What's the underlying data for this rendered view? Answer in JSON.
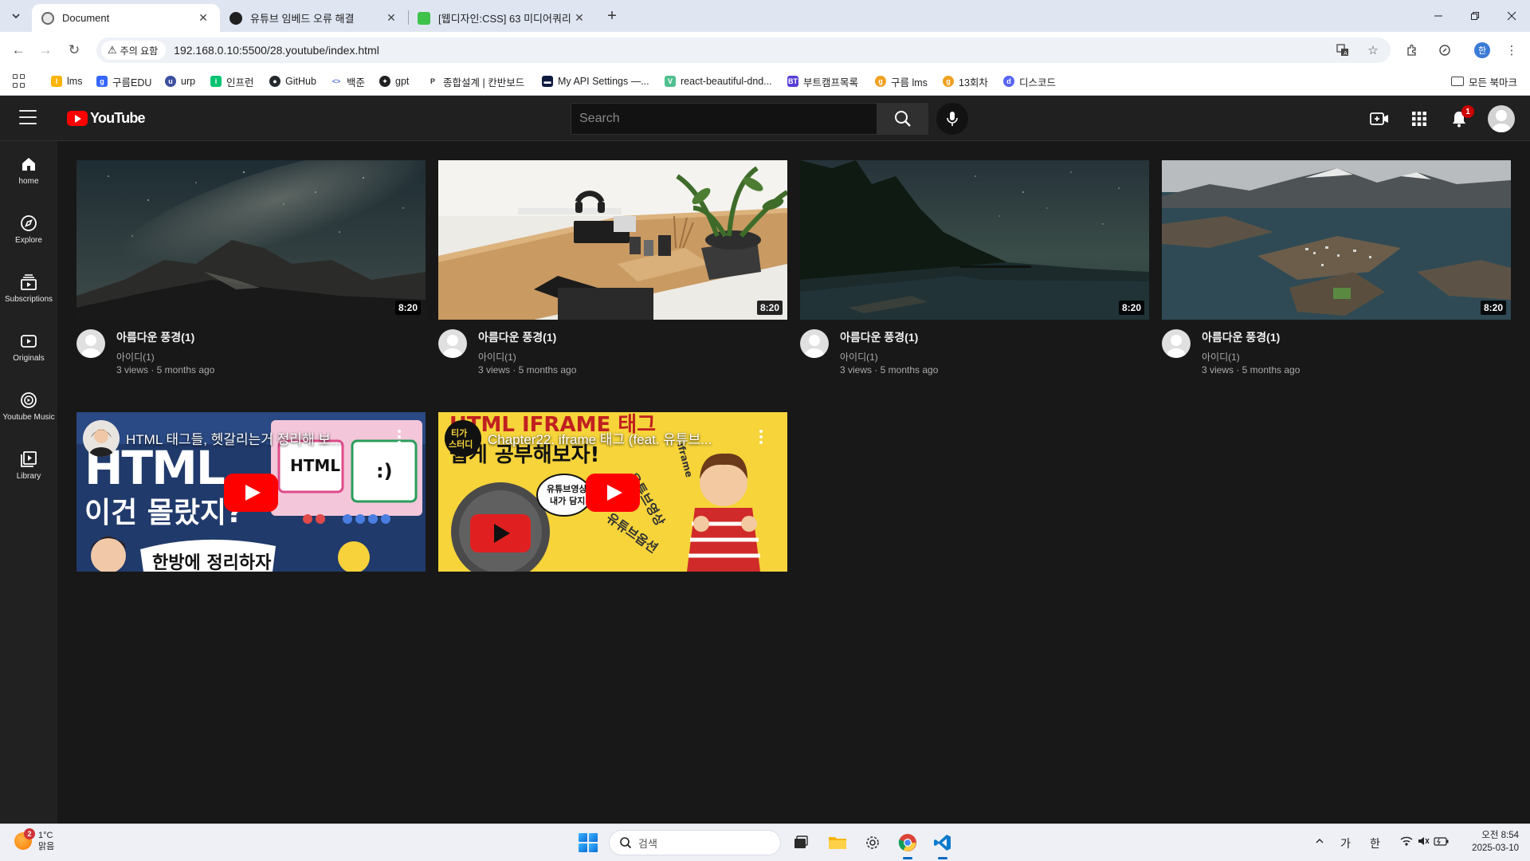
{
  "browser": {
    "tabs": [
      {
        "title": "Document",
        "active": true,
        "favicon_color": "#555555"
      },
      {
        "title": "유튜브 임베드 오류 해결",
        "active": false,
        "favicon_color": "#202020"
      },
      {
        "title": "[웹디자인:CSS] 63 미디어쿼리",
        "active": false,
        "favicon_color": "#3ec24a"
      }
    ],
    "new_tab_icon": "plus-icon",
    "address": {
      "security_label": "주의 요함",
      "url": "192.168.0.10:5500/28.youtube/index.html"
    },
    "bookmarks": [
      {
        "label": "lms",
        "color": "#ffb400"
      },
      {
        "label": "구름EDU",
        "color": "#3566ff"
      },
      {
        "label": "urp",
        "color": "#3b4fa0"
      },
      {
        "label": "인프런",
        "color": "#00c471"
      },
      {
        "label": "GitHub",
        "color": "#24292e"
      },
      {
        "label": "백준",
        "color": "#5b7bd6"
      },
      {
        "label": "gpt",
        "color": "#202020"
      },
      {
        "label": "종합설계 | 칸반보드",
        "color": "#333333"
      },
      {
        "label": "My API Settings —...",
        "color": "#0d1b3e"
      },
      {
        "label": "react-beautiful-dnd...",
        "color": "#4fc08d"
      },
      {
        "label": "부트캠프목록",
        "color": "#5a3fd6"
      },
      {
        "label": "구름 lms",
        "color": "#f0a020"
      },
      {
        "label": "13회차",
        "color": "#f0a020"
      },
      {
        "label": "디스코드",
        "color": "#5865f2"
      }
    ],
    "all_bookmarks": "모든 북마크",
    "profile_initial": "한"
  },
  "youtube": {
    "logo_text": "YouTube",
    "search_placeholder": "Search",
    "notification_count": "1",
    "sidebar": [
      {
        "label": "home",
        "icon": "home-icon"
      },
      {
        "label": "Explore",
        "icon": "compass-icon"
      },
      {
        "label": "Subscriptions",
        "icon": "subscriptions-icon"
      },
      {
        "label": "Originals",
        "icon": "originals-icon"
      },
      {
        "label": "Youtube Music",
        "icon": "music-icon"
      },
      {
        "label": "Library",
        "icon": "library-icon"
      }
    ],
    "videos": [
      {
        "title": "아름다운 풍경(1)",
        "channel": "아이디(1)",
        "stats": "3 views · 5 months ago",
        "duration": "8:20",
        "thumb": "milky-way-mountain"
      },
      {
        "title": "아름다운 풍경(1)",
        "channel": "아이디(1)",
        "stats": "3 views · 5 months ago",
        "duration": "8:20",
        "thumb": "desk-setup"
      },
      {
        "title": "아름다운 풍경(1)",
        "channel": "아이디(1)",
        "stats": "3 views · 5 months ago",
        "duration": "8:20",
        "thumb": "lake-night-sky"
      },
      {
        "title": "아름다운 풍경(1)",
        "channel": "아이디(1)",
        "stats": "3 views · 5 months ago",
        "duration": "8:20",
        "thumb": "island-town-aerial"
      }
    ],
    "embeds": [
      {
        "title": "HTML 태그들, 헷갈리는거 정리해 보...",
        "overlay_text": "HTML 이건 몰랐지? 한방에 정리하자",
        "badge": "HTML",
        "badge2": ":)"
      },
      {
        "title": "Chapter22. iframe 태그 (feat. 유튜브...",
        "overlay_text": "HTML IFRAME 태그 쉽게 공부해보자!",
        "avatar_text": "티가 스터디",
        "bubble_text": "유튜브영상 내가 담지!",
        "side_labels": [
          "유튜브영상",
          "유튜브옵션",
          "iframe"
        ]
      }
    ]
  },
  "taskbar": {
    "weather_temp": "1°C",
    "weather_desc": "맑음",
    "weather_badge": "2",
    "search_label": "검색",
    "ime_1": "가",
    "ime_2": "한",
    "time": "오전 8:54",
    "date": "2025-03-10"
  }
}
